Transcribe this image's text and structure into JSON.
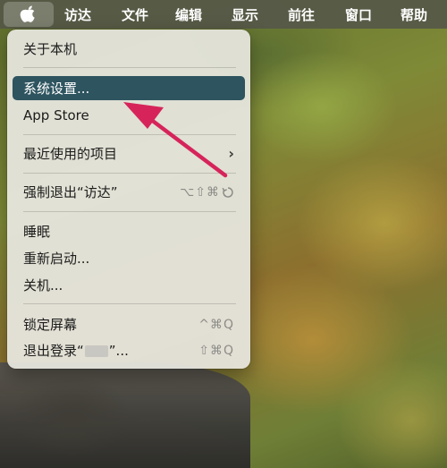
{
  "menubar": {
    "apple_icon": "apple-logo-icon",
    "items": [
      "访达",
      "文件",
      "编辑",
      "显示",
      "前往",
      "窗口",
      "帮助"
    ]
  },
  "apple_menu": {
    "items": [
      {
        "label": "关于本机"
      },
      {
        "label": "系统设置...",
        "highlighted": true
      },
      {
        "label": "App Store"
      },
      {
        "label": "最近使用的项目",
        "submenu": "›"
      },
      {
        "label": "强制退出“访达”",
        "shortcut": "⌥⇧⌘"
      },
      {
        "label": "睡眠"
      },
      {
        "label": "重新启动..."
      },
      {
        "label": "关机..."
      },
      {
        "label": "锁定屏幕",
        "shortcut": "^⌘Q"
      },
      {
        "label_prefix": "退出登录“",
        "label_suffix": "”...",
        "shortcut": "⇧⌘Q"
      }
    ]
  },
  "colors": {
    "highlight": "#2d545f",
    "annotation_arrow": "#d6245a"
  }
}
